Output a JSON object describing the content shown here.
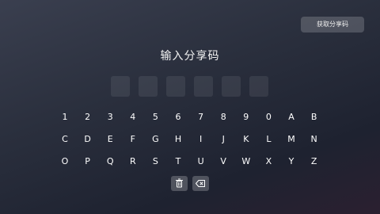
{
  "header": {
    "get_code_label": "获取分享码"
  },
  "main": {
    "title": "输入分享码"
  },
  "keyboard": {
    "rows": [
      [
        "1",
        "2",
        "3",
        "4",
        "5",
        "6",
        "7",
        "8",
        "9",
        "0",
        "A",
        "B"
      ],
      [
        "C",
        "D",
        "E",
        "F",
        "G",
        "H",
        "I",
        "J",
        "K",
        "L",
        "M",
        "N"
      ],
      [
        "O",
        "P",
        "Q",
        "R",
        "S",
        "T",
        "U",
        "V",
        "W",
        "X",
        "Y",
        "Z"
      ]
    ]
  },
  "actions": {
    "clear_icon": "trash-icon",
    "backspace_icon": "backspace-icon"
  }
}
